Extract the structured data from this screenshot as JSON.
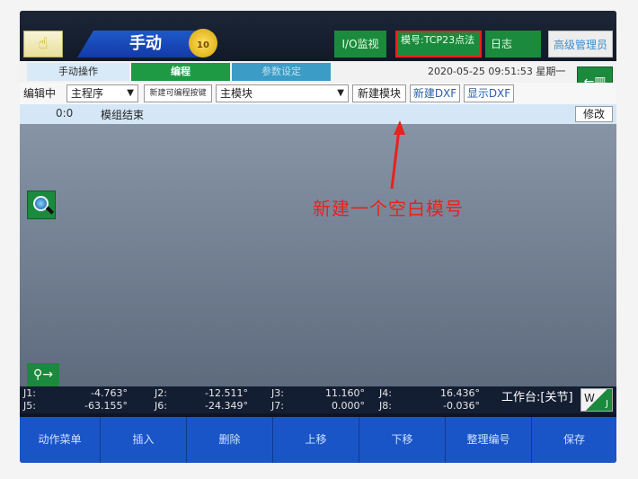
{
  "header": {
    "mode_label": "手动",
    "speed": "10",
    "io_button": "I/O监视",
    "model_label": "模号:TCP23点法",
    "log_button": "日志",
    "admin_button": "高级管理员"
  },
  "tabs": [
    {
      "label": "手动操作"
    },
    {
      "label": "编程"
    },
    {
      "label": "参数设定"
    }
  ],
  "datetime": "2020-05-25  09:51:53  星期一",
  "toolbar": {
    "editing_label": "编辑中",
    "program_select": "主程序",
    "new_editable_key": "新建可编程按键",
    "module_select": "主模块",
    "new_module": "新建模块",
    "new_dxf": "新建DXF",
    "show_dxf": "显示DXF"
  },
  "program": {
    "line_no": "0:0",
    "command": "模组结束",
    "edit_button": "修改"
  },
  "annotation": "新建一个空白模号",
  "joints": [
    {
      "name": "J1:",
      "value": "-4.763°"
    },
    {
      "name": "J2:",
      "value": "-12.511°"
    },
    {
      "name": "J3:",
      "value": "11.160°"
    },
    {
      "name": "J4:",
      "value": "16.436°"
    },
    {
      "name": "J5:",
      "value": "-63.155°"
    },
    {
      "name": "J6:",
      "value": "-24.349°"
    },
    {
      "name": "J7:",
      "value": "0.000°"
    },
    {
      "name": "J8:",
      "value": "-0.036°"
    }
  ],
  "workstation": "工作台:[关节]",
  "coord_w": "W",
  "coord_j": "J",
  "menu": [
    {
      "label": "动作菜单"
    },
    {
      "label": "插入"
    },
    {
      "label": "删除"
    },
    {
      "label": "上移"
    },
    {
      "label": "下移"
    },
    {
      "label": "整理编号"
    },
    {
      "label": "保存"
    }
  ],
  "colors": {
    "accent_green": "#1b8a3c",
    "menu_blue": "#1a55c7",
    "annotation_red": "#e8221c"
  }
}
